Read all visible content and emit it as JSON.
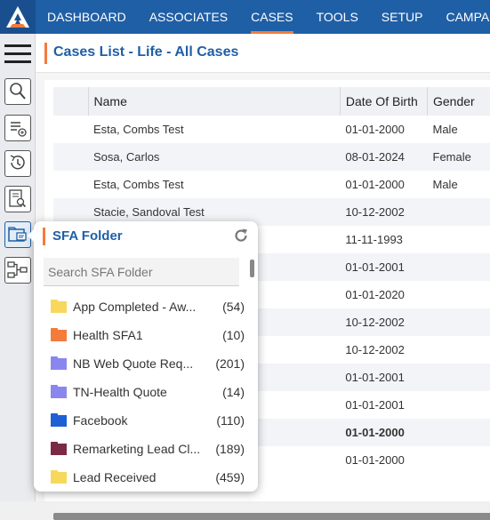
{
  "nav": [
    "DASHBOARD",
    "ASSOCIATES",
    "CASES",
    "TOOLS",
    "SETUP",
    "CAMPAIGN"
  ],
  "active_nav": "CASES",
  "page_title": "Cases List - Life - All Cases",
  "table": {
    "headers": [
      "",
      "Name",
      "Date Of Birth",
      "Gender"
    ],
    "rows": [
      {
        "name": "Esta, Combs Test",
        "dob": "01-01-2000",
        "gender": "Male"
      },
      {
        "name": "Sosa, Carlos",
        "dob": "08-01-2024",
        "gender": "Female"
      },
      {
        "name": "Esta, Combs Test",
        "dob": "01-01-2000",
        "gender": "Male"
      },
      {
        "name": "Stacie, Sandoval Test",
        "dob": "10-12-2002",
        "gender": ""
      },
      {
        "name": "",
        "dob": "11-11-1993",
        "gender": ""
      },
      {
        "name": "",
        "dob": "01-01-2001",
        "gender": ""
      },
      {
        "name": "",
        "dob": "01-01-2020",
        "gender": ""
      },
      {
        "name": "",
        "dob": "10-12-2002",
        "gender": ""
      },
      {
        "name": "",
        "dob": "10-12-2002",
        "gender": ""
      },
      {
        "name": "",
        "dob": "01-01-2001",
        "gender": ""
      },
      {
        "name": "",
        "dob": "01-01-2001",
        "gender": ""
      },
      {
        "name": "",
        "dob": "01-01-2000",
        "gender": ""
      },
      {
        "name": "",
        "dob": "01-01-2000",
        "gender": ""
      }
    ]
  },
  "sfa_folder": {
    "title": "SFA Folder",
    "search_placeholder": "Search SFA Folder",
    "folders": [
      {
        "name": "App Completed - Aw...",
        "count": "(54)",
        "color": "#f7d85c"
      },
      {
        "name": "Health SFA1",
        "count": "(10)",
        "color": "#f47b3b"
      },
      {
        "name": "NB Web Quote Req...",
        "count": "(201)",
        "color": "#8a86f0"
      },
      {
        "name": "TN-Health Quote",
        "count": "(14)",
        "color": "#8a86f0"
      },
      {
        "name": "Facebook",
        "count": "(110)",
        "color": "#1e5fd6"
      },
      {
        "name": "Remarketing Lead Cl...",
        "count": "(189)",
        "color": "#7a2a45"
      },
      {
        "name": "Lead Received",
        "count": "(459)",
        "color": "#f7d85c"
      }
    ]
  },
  "icons": {
    "logo": "app-logo",
    "menu": "hamburger-menu-icon",
    "sidebar": [
      "search-zoom-icon",
      "add-list-icon",
      "history-icon",
      "document-search-icon",
      "folder-card-icon",
      "workflow-icon"
    ],
    "refresh": "refresh-icon"
  }
}
